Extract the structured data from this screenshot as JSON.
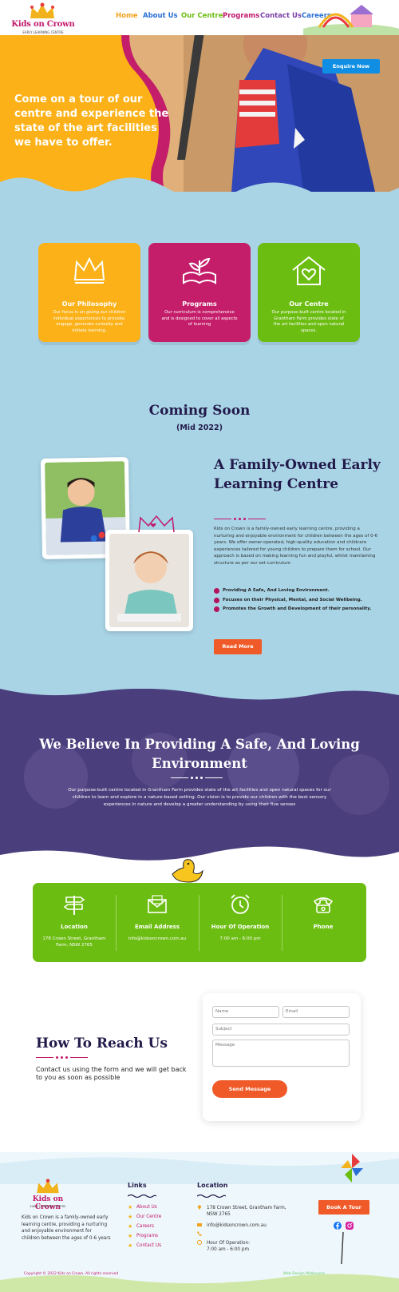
{
  "header": {
    "logo_name": "Kids on Crown",
    "logo_sub": "EARLY LEARNING CENTRE",
    "nav": [
      {
        "label": "Home",
        "color": "#f2a31b"
      },
      {
        "label": "About Us",
        "color": "#2a6fd6"
      },
      {
        "label": "Our Centre",
        "color": "#6cbd12"
      },
      {
        "label": "Programs",
        "color": "#c2186b"
      },
      {
        "label": "Contact Us",
        "color": "#7a3fa8"
      },
      {
        "label": "Careers",
        "color": "#2a6fd6"
      }
    ]
  },
  "hero": {
    "text": "Come on a tour of our centre and experience the state of the art facilities we have to offer.",
    "enquire_label": "Enquire Now"
  },
  "cards": [
    {
      "title": "Our Philosophy",
      "desc": "Our focus is on giving our children individual experiences to provoke, engage, generate curiosity and initiate learning.",
      "color": "#fbb117",
      "icon": "crown-icon"
    },
    {
      "title": "Programs",
      "desc": "Our curriculum is comprehensive and is designed to cover all aspects of learning",
      "color": "#c41e6a",
      "icon": "book-icon"
    },
    {
      "title": "Our Centre",
      "desc": "Our purpose-built centre located in Grantham Farm provides state of the art facilities and open natural spaces.",
      "color": "#6cbd12",
      "icon": "house-heart-icon"
    }
  ],
  "coming": {
    "title": "Coming Soon",
    "subtitle": "(Mid 2022)"
  },
  "family": {
    "title": "A Family-Owned Early Learning Centre",
    "desc": "Kids on Crown is a family-owned early learning centre, providing a nurturing and enjoyable environment for children between the ages of 0-6 years. We offer owner-operated, high-quality education and childcare experiences tailored for young children to prepare them for school. Our approach is based on making learning fun and playful, whilst maintaining structure as per our set curriculum",
    "bullets": [
      "Providing A Safe, And Loving Environment.",
      "Focuses on their Physical, Mental, and Social Wellbeing.",
      "Promotes the Growth and Development of their personality."
    ],
    "read_more": "Read More"
  },
  "believe": {
    "title": "We Believe In Providing A Safe, And Loving Environment",
    "desc": "Our purpose-built centre located in Grantham Farm provides state of the art facilities and open natural spaces for our children to learn and explore in a nature-based setting. Our vision is to provide our children with the best sensory experiences in nature and develop a greater understanding by using their five senses"
  },
  "info": [
    {
      "title": "Location",
      "value": "178 Crown Street, Grantham Farm, NSW 2765",
      "icon": "signpost-icon"
    },
    {
      "title": "Email Address",
      "value": "info@kidsoncrown.com.au",
      "icon": "envelope-icon"
    },
    {
      "title": "Hour Of Operation",
      "value": "7:00 am - 6:00 pm",
      "icon": "alarm-clock-icon"
    },
    {
      "title": "Phone",
      "value": "",
      "icon": "telephone-icon"
    }
  ],
  "reach": {
    "title": "How To Reach Us",
    "desc": "Contact us using the form and we will get back to you as soon as possible"
  },
  "form": {
    "name_placeholder": "Name",
    "email_placeholder": "Email",
    "subject_placeholder": "Subject",
    "message_placeholder": "Message",
    "send_label": "Send Message"
  },
  "footer": {
    "about": "Kids on Crown is a family-owned early learning centre, providing a nurturing and enjoyable environment for children between the ages of 0-6 years",
    "links_heading": "Links",
    "links": [
      "About Us",
      "Our Centre",
      "Careers",
      "Programs",
      "Contact Us"
    ],
    "location_heading": "Location",
    "address": "178 Crown Street, Grantham Farm, NSW 2765",
    "email": "info@kidsoncrown.com.au",
    "phone": "",
    "hours_label": "Hour Of Operation:",
    "hours": "7:00 am - 6:00 pm",
    "book_tour": "Book A Tour",
    "copyright": "Copyright © 2022 Kids on Crown. All rights reserved",
    "credit": "Web Design Melbourne"
  }
}
